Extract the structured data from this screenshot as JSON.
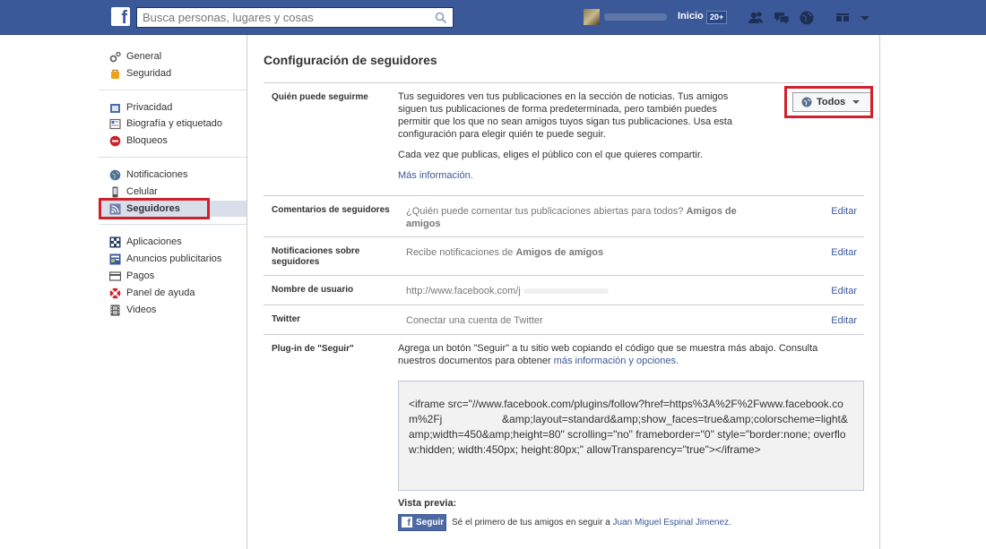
{
  "topbar": {
    "search_placeholder": "Busca personas, lugares y cosas",
    "home_label": "Inicio",
    "home_count": "20+"
  },
  "nav": {
    "group1": [
      {
        "label": "General",
        "icon": "gear-icon"
      },
      {
        "label": "Seguridad",
        "icon": "shield-icon"
      }
    ],
    "group2": [
      {
        "label": "Privacidad",
        "icon": "lock-icon"
      },
      {
        "label": "Biografía y etiquetado",
        "icon": "timeline-icon"
      },
      {
        "label": "Bloqueos",
        "icon": "block-icon"
      }
    ],
    "group3": [
      {
        "label": "Notificaciones",
        "icon": "globe-icon"
      },
      {
        "label": "Celular",
        "icon": "mobile-icon"
      },
      {
        "label": "Seguidores",
        "icon": "rss-icon",
        "active": true
      }
    ],
    "group4": [
      {
        "label": "Aplicaciones",
        "icon": "apps-icon"
      },
      {
        "label": "Anuncios publicitarios",
        "icon": "ads-icon"
      },
      {
        "label": "Pagos",
        "icon": "payments-icon"
      },
      {
        "label": "Panel de ayuda",
        "icon": "lifebuoy-icon"
      },
      {
        "label": "Videos",
        "icon": "film-icon"
      }
    ]
  },
  "main": {
    "title": "Configuración de seguidores",
    "who_can_follow": {
      "label": "Quién puede seguirme",
      "description": "Tus seguidores ven tus publicaciones en la sección de noticias. Tus amigos siguen tus publicaciones de forma predeterminada, pero también puedes permitir que los que no sean amigos tuyos sigan tus publicaciones. Usa esta configuración para elegir quién te puede seguir.",
      "note": "Cada vez que publicas, eliges el público con el que quieres compartir.",
      "more_info": "Más información.",
      "audience": "Todos"
    },
    "comments": {
      "label": "Comentarios de seguidores",
      "text": "¿Quién puede comentar tus publicaciones abiertas para todos?",
      "value": "Amigos de amigos",
      "edit": "Editar"
    },
    "notifications": {
      "label": "Notificaciones sobre seguidores",
      "text": "Recibe notificaciones de",
      "value": "Amigos de amigos",
      "edit": "Editar"
    },
    "username": {
      "label": "Nombre de usuario",
      "value": "http://www.facebook.com/j",
      "edit": "Editar"
    },
    "twitter": {
      "label": "Twitter",
      "value": "Conectar una cuenta de Twitter",
      "edit": "Editar"
    },
    "plugin": {
      "label": "Plug-in de \"Seguir\"",
      "text": "Agrega un botón \"Seguir\" a tu sitio web copiando el código que se muestra más abajo. Consulta nuestros documentos para obtener",
      "link": "más información y opciones.",
      "code": "<iframe src=\"//www.facebook.com/plugins/follow?href=https%3A%2F%2Fwww.facebook.com%2Fj                    &amp;layout=standard&amp;show_faces=true&amp;colorscheme=light&amp;width=450&amp;height=80\" scrolling=\"no\" frameborder=\"0\" style=\"border:none; overflow:hidden; width:450px; height:80px;\" allowTransparency=\"true\"></iframe>",
      "preview_label": "Vista previa:",
      "follow_button": "Seguir",
      "preview_text": "Sé el primero de tus amigos en seguir a",
      "preview_name": "Juan Miguel Espinal Jimenez."
    }
  }
}
